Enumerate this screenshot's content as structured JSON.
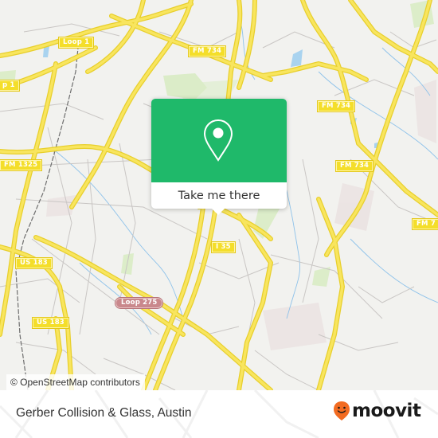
{
  "map": {
    "road_labels": [
      {
        "id": "loop-1-top",
        "text": "Loop 1"
      },
      {
        "id": "loop-1-left",
        "text": "p 1"
      },
      {
        "id": "fm-734-top",
        "text": "FM 734"
      },
      {
        "id": "fm-734-right-1",
        "text": "FM 734"
      },
      {
        "id": "fm-734-right-2",
        "text": "FM 734"
      },
      {
        "id": "fm-734-right-3",
        "text": "FM 7"
      },
      {
        "id": "fm-1325",
        "text": "FM 1325"
      },
      {
        "id": "i-35",
        "text": "I 35"
      },
      {
        "id": "us-183-upper",
        "text": "US 183"
      },
      {
        "id": "us-183-lower",
        "text": "US 183"
      },
      {
        "id": "loop-275",
        "text": "Loop 275"
      }
    ],
    "attribution": "© OpenStreetMap contributors"
  },
  "popup": {
    "icon": "location-pin-icon",
    "button_label": "Take me there",
    "color": "#1fb96a"
  },
  "footer": {
    "place_title": "Gerber Collision & Glass, Austin",
    "brand_name": "moovit",
    "brand_icon": "moovit-logo-icon",
    "brand_color": "#f26b21"
  }
}
